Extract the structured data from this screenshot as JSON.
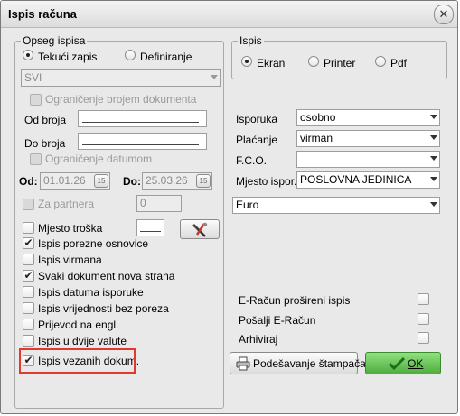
{
  "window": {
    "title": "Ispis računa",
    "close_glyph": "✕"
  },
  "opseg": {
    "title": "Opseg ispisa",
    "radio_tekuci": "Tekući zapis",
    "radio_definiranje": "Definiranje",
    "scope_select": "SVI",
    "ogr_broj": "Ograničenje brojem dokumenta",
    "od_broja": "Od broja",
    "do_broja": "Do broja",
    "ogr_datum": "Ograničenje datumom",
    "od_label": "Od:",
    "od_value": "01.01.26",
    "do_label": "Do:",
    "do_value": "25.03.26",
    "cal_glyph": "15",
    "za_partnera": "Za partnera",
    "partner_value": "0",
    "mjesto_troska": "Mjesto troška",
    "checks": [
      {
        "label": "Ispis porezne osnovice",
        "checked": true
      },
      {
        "label": "Ispis virmana",
        "checked": false
      },
      {
        "label": "Svaki dokument nova strana",
        "checked": true
      },
      {
        "label": "Ispis datuma isporuke",
        "checked": false
      },
      {
        "label": "Ispis vrijednosti bez poreza",
        "checked": false
      },
      {
        "label": "Prijevod na engl.",
        "checked": false
      },
      {
        "label": "Ispis u dvije valute",
        "checked": false
      },
      {
        "label": "Ispis vezanih dokum.",
        "checked": true
      }
    ]
  },
  "ispis": {
    "title": "Ispis",
    "ekran": "Ekran",
    "printer": "Printer",
    "pdf": "Pdf"
  },
  "fields": {
    "isporuka_label": "Isporuka",
    "isporuka_value": "osobno",
    "placanje_label": "Plaćanje",
    "placanje_value": "virman",
    "fco_label": "F.C.O.",
    "fco_value": "",
    "mjesto_label": "Mjesto ispor.",
    "mjesto_value": "POSLOVNA JEDINICA",
    "currency_value": "Euro"
  },
  "right_checks": [
    "E-Račun prošireni ispis",
    "Pošalji E-Račun",
    "Arhiviraj"
  ],
  "buttons": {
    "printer_setup": "Podešavanje štampača",
    "ok": "OK"
  },
  "colors": {
    "highlight": "#e03a2f",
    "ok_button": "#5fc24c"
  }
}
